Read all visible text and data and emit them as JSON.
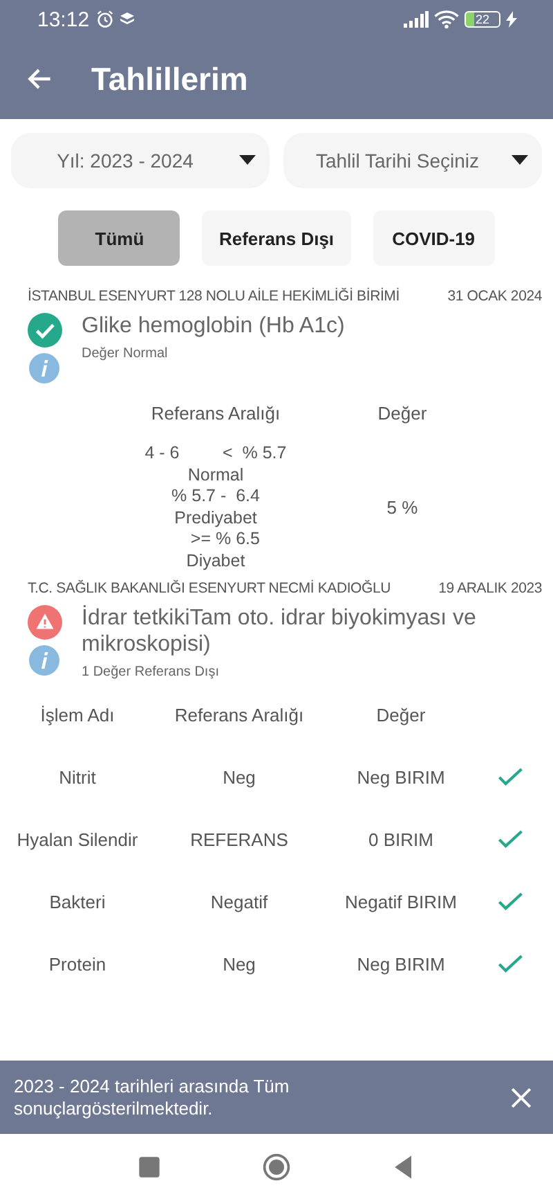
{
  "status_bar": {
    "time": "13:12",
    "battery": "22"
  },
  "app_bar": {
    "title": "Tahlillerim"
  },
  "filters": [
    {
      "label": "Yıl: 2023 - 2024"
    },
    {
      "label": "Tahlil Tarihi Seçiniz"
    }
  ],
  "tabs": [
    {
      "label": "Tümü",
      "selected": true
    },
    {
      "label": "Referans Dışı",
      "selected": false
    },
    {
      "label": "COVID-19",
      "selected": false
    }
  ],
  "results": [
    {
      "institution": "İSTANBUL ESENYURT 128 NOLU AİLE HEKİMLİĞİ BİRİMİ",
      "date": "31 OCAK 2024",
      "out_of_range": false,
      "test": "Glike hemoglobin (Hb A1c)",
      "summary": "Değer Normal",
      "kind": "single",
      "columns": [
        "Referans Aralığı",
        "Değer"
      ],
      "reference": "4 - 6         <  % 5.7\nNormal\n% 5.7 -  6.4\nPrediyabet\n    >= % 6.5\nDiyabet",
      "value": "5 %"
    },
    {
      "institution": "T.C. SAĞLIK BAKANLIĞI ESENYURT NECMİ KADIOĞLU",
      "date": "19 ARALIK 2023",
      "out_of_range": true,
      "test": "İdrar tetkikiTam oto. idrar biyokimyası ve mikroskopisi)",
      "summary": "1 Değer Referans Dışı",
      "kind": "table",
      "columns": [
        "İşlem Adı",
        "Referans Aralığı",
        "Değer"
      ],
      "rows": [
        {
          "name": "Nitrit",
          "reference": "Neg",
          "value": "Neg BIRIM",
          "ok": true
        },
        {
          "name": "Hyalan Silendir",
          "reference": "REFERANS",
          "value": "0 BIRIM",
          "ok": true
        },
        {
          "name": "Bakteri",
          "reference": "Negatif",
          "value": "Negatif BIRIM",
          "ok": true
        },
        {
          "name": "Protein",
          "reference": "Neg",
          "value": "Neg BIRIM",
          "ok": true
        }
      ]
    }
  ],
  "snackbar": {
    "message": "2023 - 2024 tarihleri arasında Tüm sonuçlargösterilmektedir."
  }
}
